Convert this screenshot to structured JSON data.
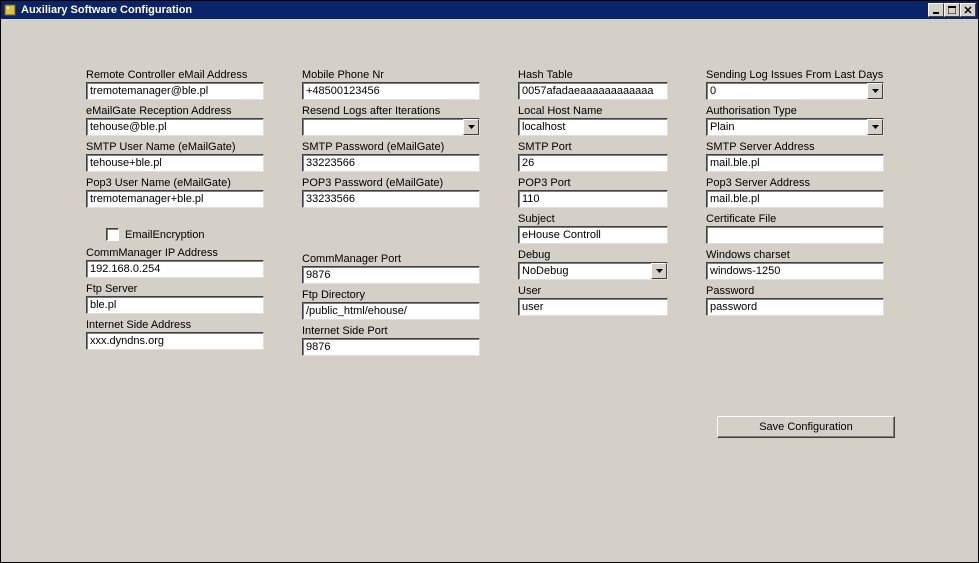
{
  "window": {
    "title": "Auxiliary Software Configuration"
  },
  "col1": {
    "remote_email_label": "Remote Controller eMail Address",
    "remote_email_value": "tremotemanager@ble.pl",
    "reception_label": "eMailGate Reception Address",
    "reception_value": "tehouse@ble.pl",
    "smtp_user_label": "SMTP User Name (eMailGate)",
    "smtp_user_value": "tehouse+ble.pl",
    "pop3_user_label": "Pop3 User Name (eMailGate)",
    "pop3_user_value": "tremotemanager+ble.pl",
    "email_encryption_label": "EmailEncryption",
    "cm_ip_label": "CommManager IP Address",
    "cm_ip_value": "192.168.0.254",
    "ftp_server_label": "Ftp Server",
    "ftp_server_value": "ble.pl",
    "inet_addr_label": "Internet Side Address",
    "inet_addr_value": "xxx.dyndns.org"
  },
  "col2": {
    "mobile_label": "Mobile Phone Nr",
    "mobile_value": "+48500123456",
    "resend_label": "Resend Logs after Iterations",
    "resend_value": "",
    "smtp_pw_label": "SMTP Password (eMailGate)",
    "smtp_pw_value": "33223566",
    "pop3_pw_label": "POP3 Password (eMailGate)",
    "pop3_pw_value": "33233566",
    "cm_port_label": "CommManager Port",
    "cm_port_value": "9876",
    "ftp_dir_label": "Ftp Directory",
    "ftp_dir_value": "/public_html/ehouse/",
    "inet_port_label": "Internet Side Port",
    "inet_port_value": "9876"
  },
  "col3": {
    "hash_label": "Hash Table",
    "hash_value": "0057afadaeaaaaaaaaaaaa",
    "localhost_label": "Local Host Name",
    "localhost_value": "localhost",
    "smtp_port_label": "SMTP Port",
    "smtp_port_value": "26",
    "pop3_port_label": "POP3 Port",
    "pop3_port_value": "110",
    "subject_label": "Subject",
    "subject_value": "eHouse Controll",
    "debug_label": "Debug",
    "debug_value": "NoDebug",
    "user_label": "User",
    "user_value": "user"
  },
  "col4": {
    "log_days_label": "Sending Log Issues From Last Days",
    "log_days_value": "0",
    "auth_label": "Authorisation Type",
    "auth_value": "Plain",
    "smtp_srv_label": "SMTP Server Address",
    "smtp_srv_value": "mail.ble.pl",
    "pop3_srv_label": "Pop3 Server Address",
    "pop3_srv_value": "mail.ble.pl",
    "cert_label": "Certificate File",
    "cert_value": "",
    "charset_label": "Windows charset",
    "charset_value": "windows-1250",
    "password_label": "Password",
    "password_value": "password"
  },
  "buttons": {
    "save": "Save Configuration"
  }
}
